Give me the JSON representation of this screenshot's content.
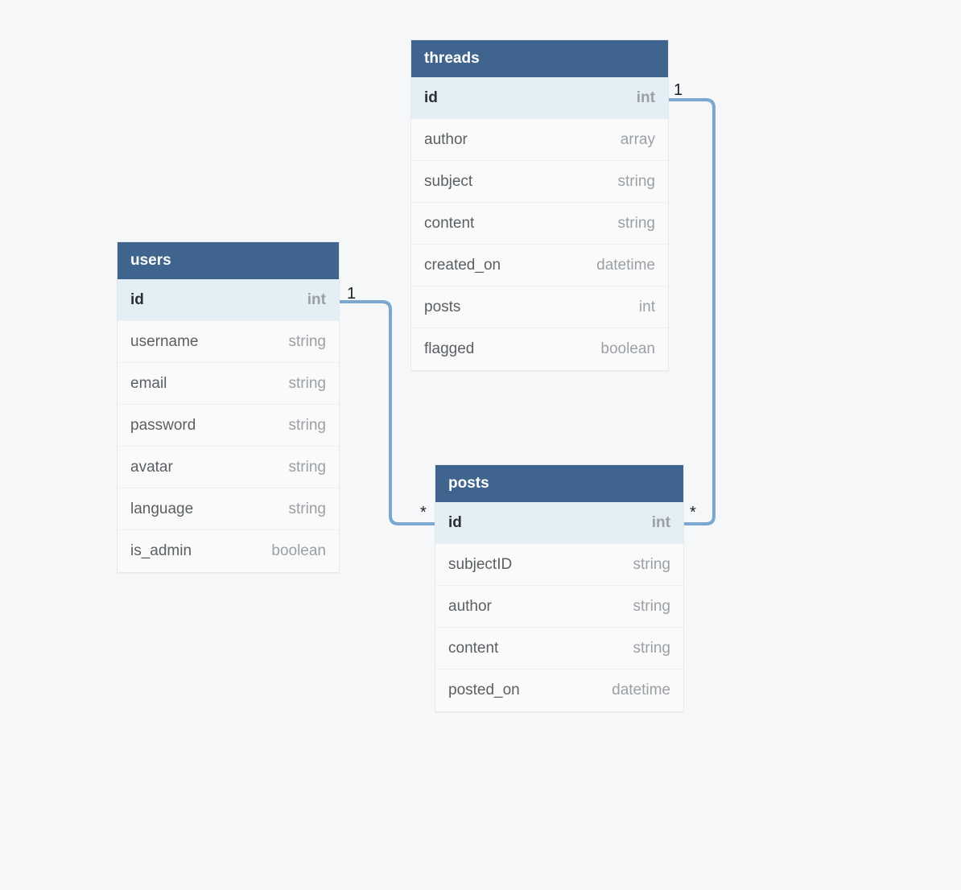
{
  "entities": {
    "users": {
      "title": "users",
      "fields": [
        {
          "name": "id",
          "type": "int",
          "pk": true
        },
        {
          "name": "username",
          "type": "string"
        },
        {
          "name": "email",
          "type": "string"
        },
        {
          "name": "password",
          "type": "string"
        },
        {
          "name": "avatar",
          "type": "string"
        },
        {
          "name": "language",
          "type": "string"
        },
        {
          "name": "is_admin",
          "type": "boolean"
        }
      ]
    },
    "threads": {
      "title": "threads",
      "fields": [
        {
          "name": "id",
          "type": "int",
          "pk": true
        },
        {
          "name": "author",
          "type": "array"
        },
        {
          "name": "subject",
          "type": "string"
        },
        {
          "name": "content",
          "type": "string"
        },
        {
          "name": "created_on",
          "type": "datetime"
        },
        {
          "name": "posts",
          "type": "int"
        },
        {
          "name": "flagged",
          "type": "boolean"
        }
      ]
    },
    "posts": {
      "title": "posts",
      "fields": [
        {
          "name": "id",
          "type": "int",
          "pk": true
        },
        {
          "name": "subjectID",
          "type": "string"
        },
        {
          "name": "author",
          "type": "string"
        },
        {
          "name": "content",
          "type": "string"
        },
        {
          "name": "posted_on",
          "type": "datetime"
        }
      ]
    }
  },
  "relationships": [
    {
      "from": "users.id",
      "from_card": "1",
      "to": "posts.id",
      "to_card": "*"
    },
    {
      "from": "threads.id",
      "from_card": "1",
      "to": "posts.id",
      "to_card": "*"
    }
  ],
  "cardinality_labels": {
    "users_one": "1",
    "posts_many_left": "*",
    "threads_one": "1",
    "posts_many_right": "*"
  }
}
